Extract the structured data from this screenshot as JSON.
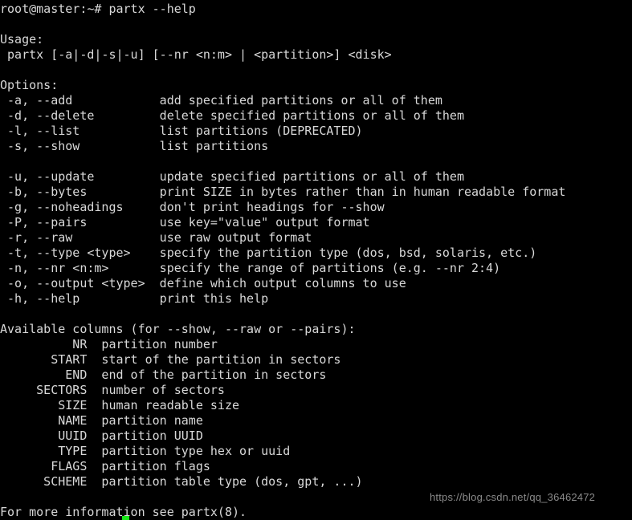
{
  "terminal": {
    "colors": {
      "background": "#000000",
      "foreground": "#d8d8d8",
      "cursor": "#19e619",
      "watermark": "#8a8a8a"
    },
    "prompt": "root@master:~# ",
    "command": "partx --help",
    "prompt_line": "root@master:~# partx --help",
    "cursor_visible": true
  },
  "help": {
    "usage_heading": "Usage:",
    "usage_line": " partx [-a|-d|-s|-u] [--nr <n:m> | <partition>] <disk>",
    "options_heading": "Options:",
    "options": [
      {
        "flag": " -a, --add",
        "desc": "add specified partitions or all of them"
      },
      {
        "flag": " -d, --delete",
        "desc": "delete specified partitions or all of them"
      },
      {
        "flag": " -l, --list",
        "desc": "list partitions (DEPRECATED)"
      },
      {
        "flag": " -s, --show",
        "desc": "list partitions"
      },
      {
        "flag": "",
        "desc": ""
      },
      {
        "flag": " -u, --update",
        "desc": "update specified partitions or all of them"
      },
      {
        "flag": " -b, --bytes",
        "desc": "print SIZE in bytes rather than in human readable format"
      },
      {
        "flag": " -g, --noheadings",
        "desc": "don't print headings for --show"
      },
      {
        "flag": " -P, --pairs",
        "desc": "use key=\"value\" output format"
      },
      {
        "flag": " -r, --raw",
        "desc": "use raw output format"
      },
      {
        "flag": " -t, --type <type>",
        "desc": "specify the partition type (dos, bsd, solaris, etc.)"
      },
      {
        "flag": " -n, --nr <n:m>",
        "desc": "specify the range of partitions (e.g. --nr 2:4)"
      },
      {
        "flag": " -o, --output <type>",
        "desc": "define which output columns to use"
      },
      {
        "flag": " -h, --help",
        "desc": "print this help"
      }
    ],
    "columns_heading": "Available columns (for --show, --raw or --pairs):",
    "columns": [
      {
        "name": "NR",
        "desc": "partition number"
      },
      {
        "name": "START",
        "desc": "start of the partition in sectors"
      },
      {
        "name": "END",
        "desc": "end of the partition in sectors"
      },
      {
        "name": "SECTORS",
        "desc": "number of sectors"
      },
      {
        "name": "SIZE",
        "desc": "human readable size"
      },
      {
        "name": "NAME",
        "desc": "partition name"
      },
      {
        "name": "UUID",
        "desc": "partition UUID"
      },
      {
        "name": "TYPE",
        "desc": "partition type hex or uuid"
      },
      {
        "name": "FLAGS",
        "desc": "partition flags"
      },
      {
        "name": "SCHEME",
        "desc": "partition table type (dos, gpt, ...)"
      }
    ],
    "footer": "For more information see partx(8)."
  },
  "watermark": {
    "text": "https://blog.csdn.net/qq_36462472"
  }
}
